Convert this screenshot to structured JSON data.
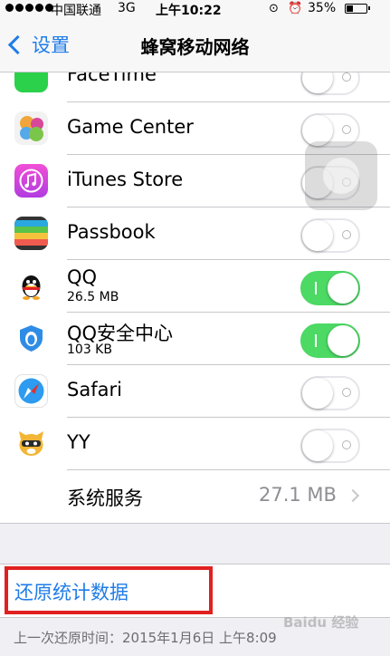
{
  "status_bar": {
    "carrier": "中国联通",
    "network": "3G",
    "time": "上午10:22",
    "battery": "35%",
    "battery_level": 0.35
  },
  "nav": {
    "back_label": "设置",
    "title": "蜂窝移动网络"
  },
  "apps": [
    {
      "name": "FaceTime",
      "icon": "facetime-icon",
      "enabled": false
    },
    {
      "name": "Game Center",
      "icon": "game-center-icon",
      "enabled": false
    },
    {
      "name": "iTunes Store",
      "icon": "itunes-store-icon",
      "enabled": false
    },
    {
      "name": "Passbook",
      "icon": "passbook-icon",
      "enabled": false
    },
    {
      "name": "QQ",
      "usage": "26.5 MB",
      "icon": "qq-icon",
      "enabled": true
    },
    {
      "name": "QQ安全中心",
      "usage": "103 KB",
      "icon": "qq-security-icon",
      "enabled": true
    },
    {
      "name": "Safari",
      "icon": "safari-icon",
      "enabled": false
    },
    {
      "name": "YY",
      "icon": "yy-icon",
      "enabled": false
    }
  ],
  "system_services": {
    "label": "系统服务",
    "value": "27.1 MB"
  },
  "reset": {
    "label": "还原统计数据",
    "footnote": "上一次还原时间：2015年1月6日 上午8:09"
  },
  "watermark": "Baidu 经验",
  "colors": {
    "accent": "#1f7ce8",
    "switch_on": "#4cd964",
    "highlight": "#e02020"
  }
}
